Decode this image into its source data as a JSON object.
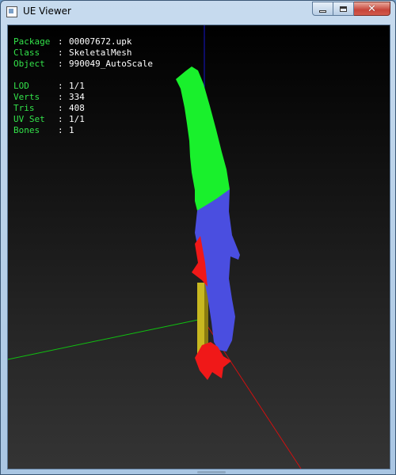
{
  "window": {
    "title": "UE Viewer",
    "icon": "app-icon"
  },
  "caption_buttons": {
    "minimize_icon": "minimize-icon",
    "maximize_icon": "maximize-icon",
    "close_icon": "close-icon",
    "close_glyph": "✕"
  },
  "info": {
    "package": {
      "label": "Package",
      "sep": ":",
      "value": "00007672.upk"
    },
    "class": {
      "label": "Class",
      "sep": ":",
      "value": "SkeletalMesh"
    },
    "object": {
      "label": "Object",
      "sep": ":",
      "value": "990049_AutoScale"
    },
    "lod": {
      "label": "LOD",
      "sep": ":",
      "value": "1/1"
    },
    "verts": {
      "label": "Verts",
      "sep": ":",
      "value": "334"
    },
    "tris": {
      "label": "Tris",
      "sep": ":",
      "value": "408"
    },
    "uvset": {
      "label": "UV Set",
      "sep": ":",
      "value": "1/1"
    },
    "bones": {
      "label": "Bones",
      "sep": ":",
      "value": "1"
    }
  },
  "colors": {
    "label_green": "#33e34a",
    "value_white": "#ffffff",
    "mesh_green": "#19f02c",
    "mesh_blue": "#4a4ee0",
    "mesh_red": "#f01818",
    "bone_yellow": "#c8b820",
    "axis_x_red": "#d01010",
    "axis_y_green": "#10c010",
    "axis_z_blue": "#1414c8"
  }
}
